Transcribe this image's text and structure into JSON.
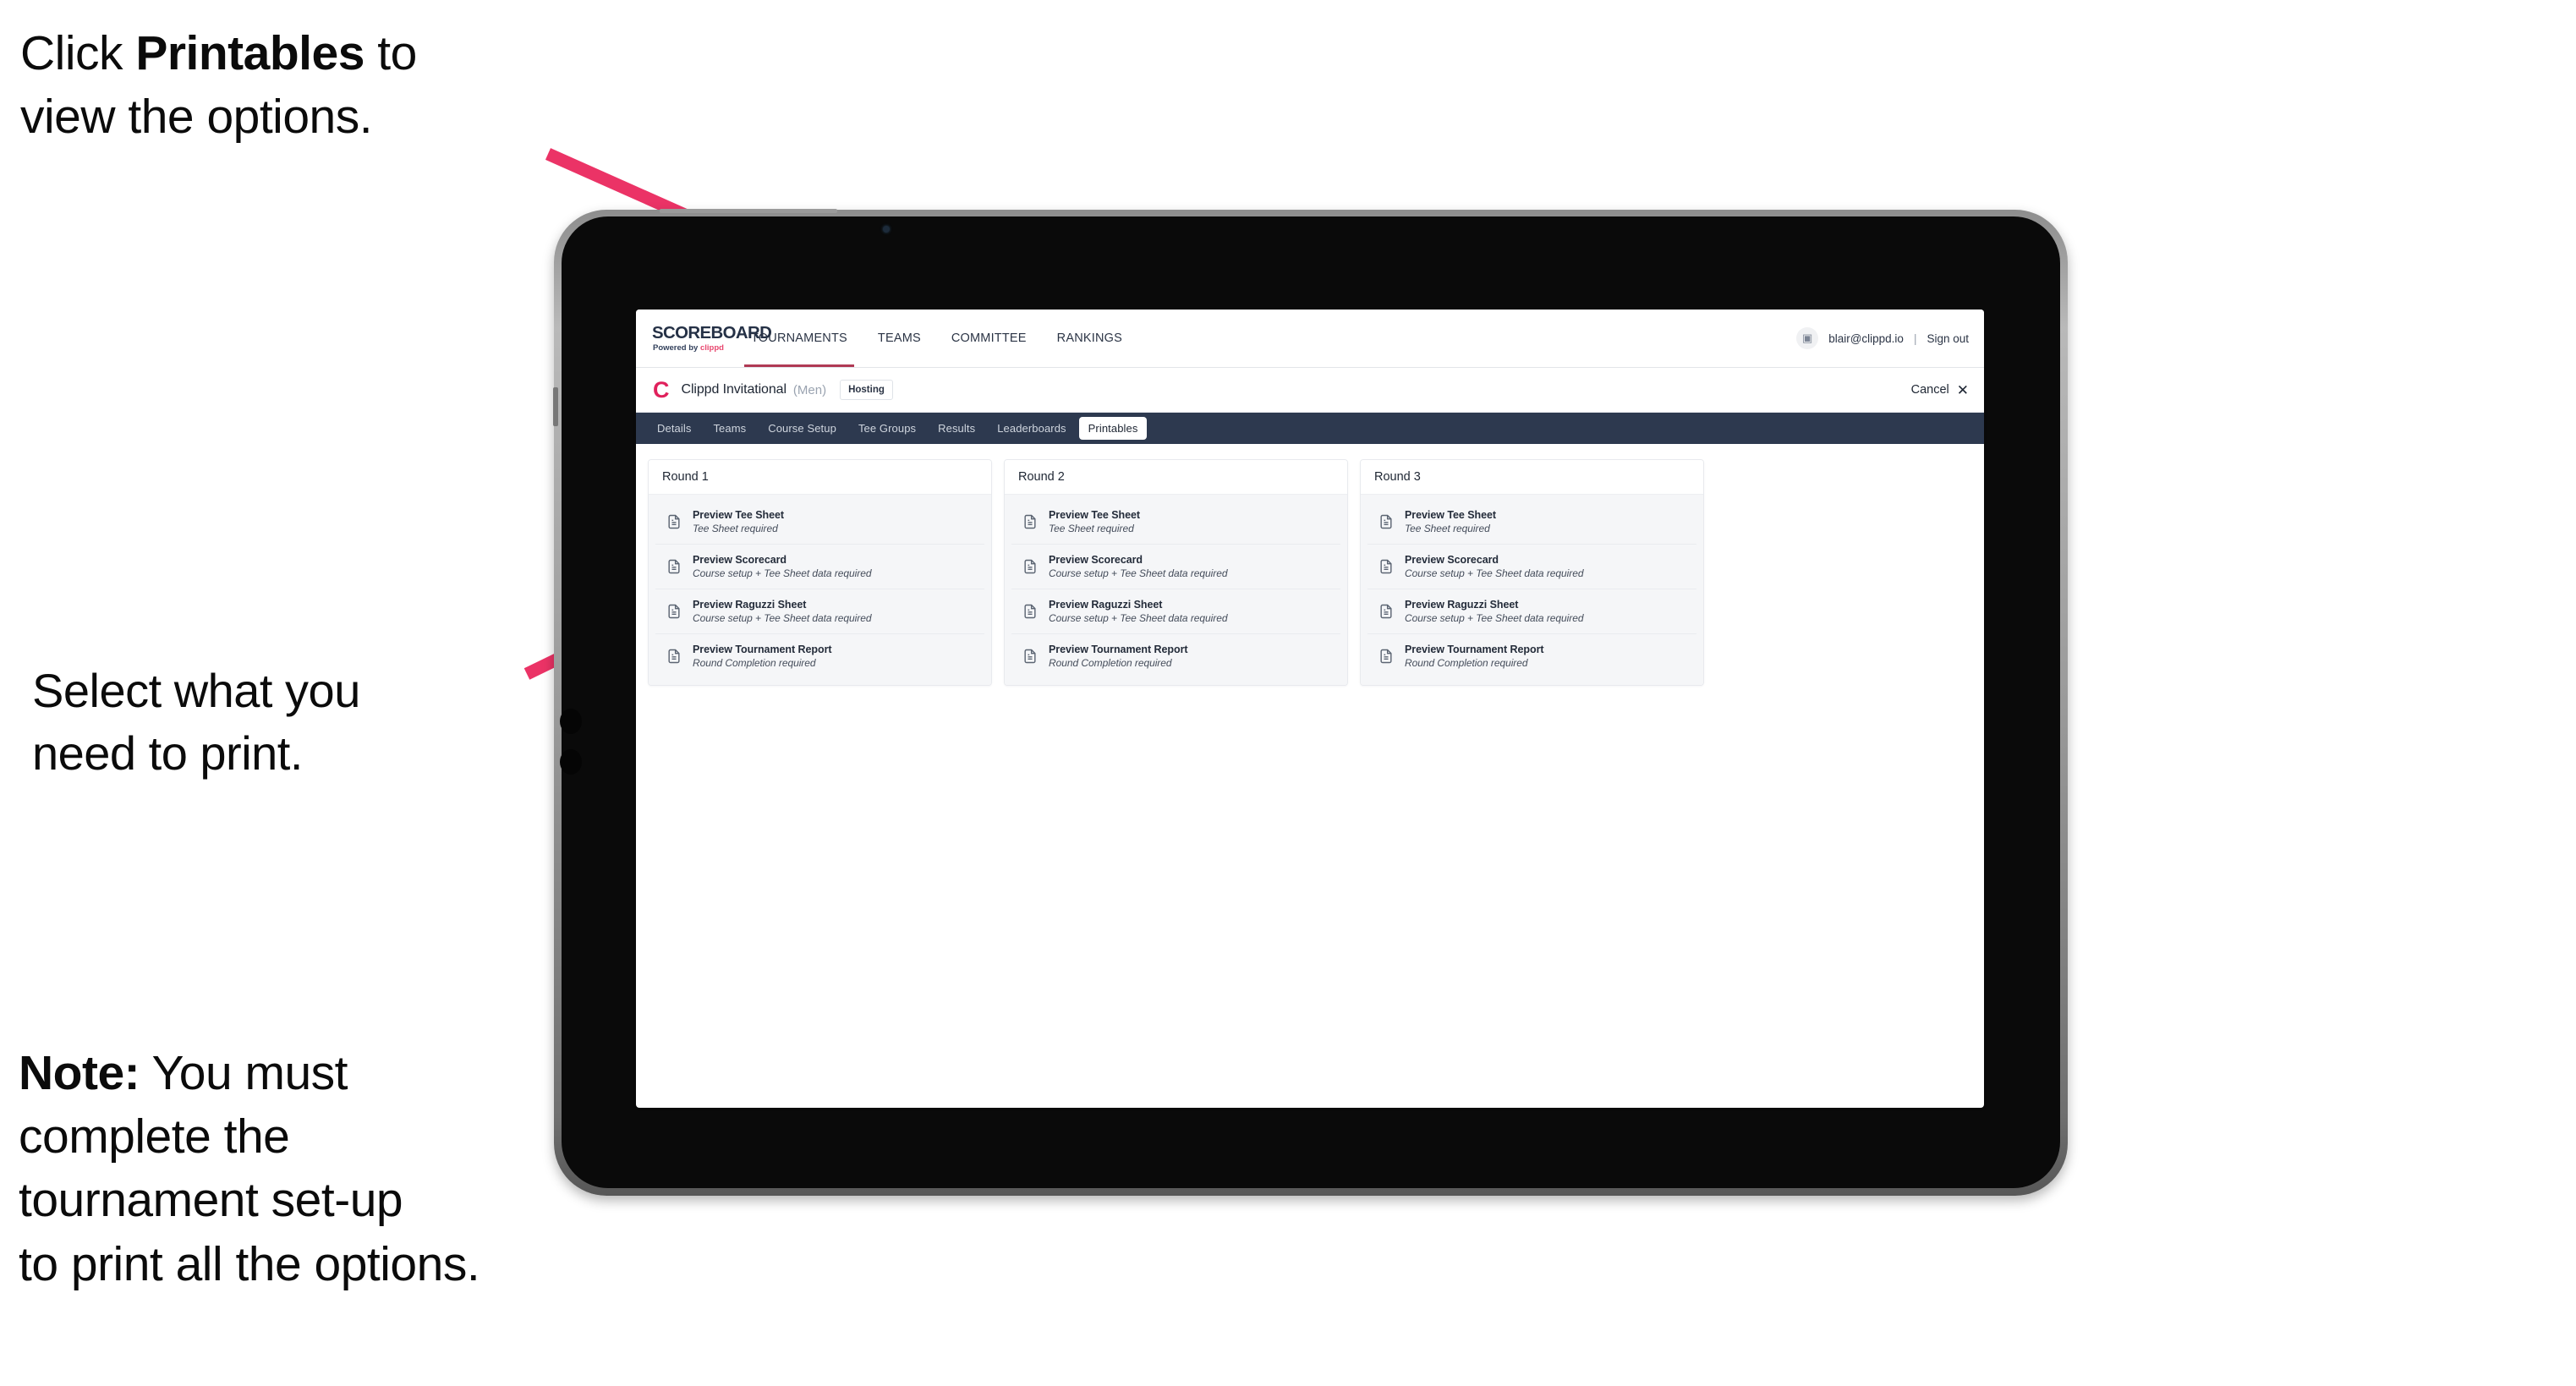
{
  "annotations": {
    "top": {
      "pre": "Click ",
      "bold": "Printables",
      "post": " to\nview the options."
    },
    "middle": {
      "text": "Select what you\n need to print."
    },
    "note": {
      "bold": "Note:",
      "text": " You must\ncomplete the\ntournament set-up\nto print all the options."
    },
    "arrow_color": "#eb3366"
  },
  "app": {
    "brand": {
      "title": "SCOREBOARD",
      "powered_prefix": "Powered by ",
      "powered_name": "clippd"
    },
    "topnav": [
      {
        "label": "TOURNAMENTS",
        "active": true
      },
      {
        "label": "TEAMS",
        "active": false
      },
      {
        "label": "COMMITTEE",
        "active": false
      },
      {
        "label": "RANKINGS",
        "active": false
      }
    ],
    "user": {
      "avatar_glyph": "▣",
      "email": "blair@clippd.io",
      "separator": "|",
      "sign_out": "Sign out"
    },
    "tournament": {
      "logo_letter": "C",
      "name": "Clippd Invitational",
      "gender": "(Men)",
      "status_badge": "Hosting",
      "cancel_label": "Cancel",
      "cancel_icon": "✕"
    },
    "tabs": [
      {
        "label": "Details",
        "active": false
      },
      {
        "label": "Teams",
        "active": false
      },
      {
        "label": "Course Setup",
        "active": false
      },
      {
        "label": "Tee Groups",
        "active": false
      },
      {
        "label": "Results",
        "active": false
      },
      {
        "label": "Leaderboards",
        "active": false
      },
      {
        "label": "Printables",
        "active": true
      }
    ],
    "rounds": [
      {
        "title": "Round 1",
        "items": [
          {
            "title": "Preview Tee Sheet",
            "sub": "Tee Sheet required"
          },
          {
            "title": "Preview Scorecard",
            "sub": "Course setup + Tee Sheet data required"
          },
          {
            "title": "Preview Raguzzi Sheet",
            "sub": "Course setup + Tee Sheet data required"
          },
          {
            "title": "Preview Tournament Report",
            "sub": "Round Completion required"
          }
        ]
      },
      {
        "title": "Round 2",
        "items": [
          {
            "title": "Preview Tee Sheet",
            "sub": "Tee Sheet required"
          },
          {
            "title": "Preview Scorecard",
            "sub": "Course setup + Tee Sheet data required"
          },
          {
            "title": "Preview Raguzzi Sheet",
            "sub": "Course setup + Tee Sheet data required"
          },
          {
            "title": "Preview Tournament Report",
            "sub": "Round Completion required"
          }
        ]
      },
      {
        "title": "Round 3",
        "items": [
          {
            "title": "Preview Tee Sheet",
            "sub": "Tee Sheet required"
          },
          {
            "title": "Preview Scorecard",
            "sub": "Course setup + Tee Sheet data required"
          },
          {
            "title": "Preview Raguzzi Sheet",
            "sub": "Course setup + Tee Sheet data required"
          },
          {
            "title": "Preview Tournament Report",
            "sub": "Round Completion required"
          }
        ]
      }
    ],
    "colors": {
      "tabbar": "#2d394f",
      "brand_pink": "#e8466e",
      "tournament_logo": "#e0215c",
      "active_underline": "#b03a54"
    }
  }
}
